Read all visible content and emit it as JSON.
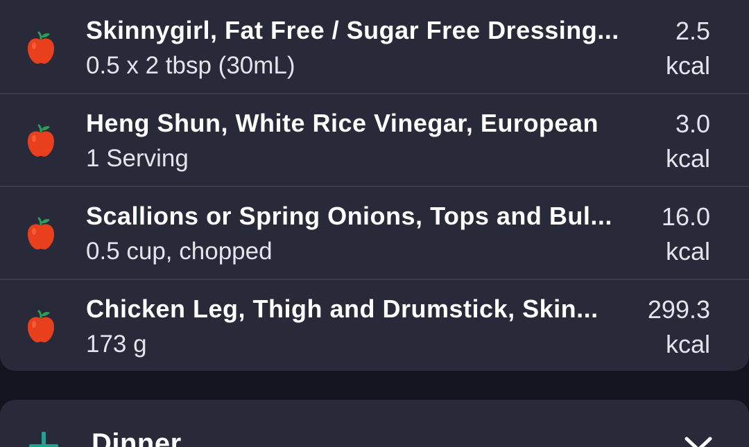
{
  "meal_entries": [
    {
      "name": "Skinnygirl, Fat Free / Sugar Free Dressing...",
      "serving": "0.5 x 2  tbsp (30mL)",
      "kcal": "2.5",
      "unit": "kcal",
      "icon": "apple-icon"
    },
    {
      "name": "Heng Shun, White Rice Vinegar, European",
      "serving": "1 Serving",
      "kcal": "3.0",
      "unit": "kcal",
      "icon": "apple-icon"
    },
    {
      "name": "Scallions or Spring Onions, Tops and Bul...",
      "serving": "0.5 cup, chopped",
      "kcal": "16.0",
      "unit": "kcal",
      "icon": "apple-icon"
    },
    {
      "name": "Chicken Leg, Thigh and Drumstick, Skin...",
      "serving": "173 g",
      "kcal": "299.3",
      "unit": "kcal",
      "icon": "apple-icon"
    }
  ],
  "dinner_section": {
    "title": "Dinner",
    "add_icon": "plus-icon",
    "expand_icon": "chevron-down-icon"
  },
  "colors": {
    "background": "#13141f",
    "card": "#282a39",
    "divider": "#3b3d4e",
    "accent_teal": "#1fa38f",
    "apple_red": "#e8401c",
    "apple_leaf": "#2f9e55"
  }
}
